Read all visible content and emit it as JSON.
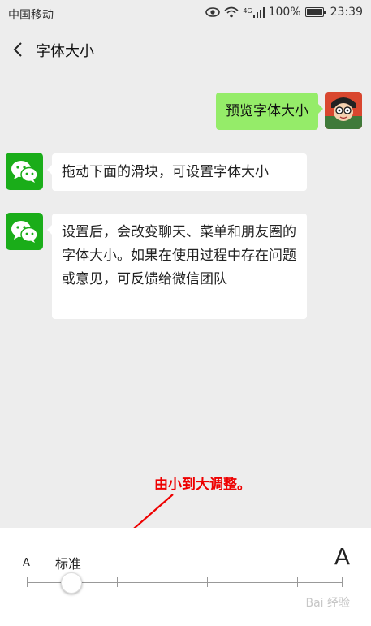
{
  "status_bar": {
    "carrier": "中国移动",
    "network": "4G",
    "battery": "100%",
    "time": "23:39"
  },
  "nav": {
    "title": "字体大小"
  },
  "messages": {
    "preview": "预览字体大小",
    "msg1": "拖动下面的滑块，可设置字体大小",
    "msg2": "设置后，会改变聊天、菜单和朋友圈的字体大小。如果在使用过程中存在问题或意见，可反馈给微信团队"
  },
  "annotation": {
    "text": "由小到大调整。"
  },
  "font_panel": {
    "small_label": "A",
    "standard_label": "标准",
    "large_label": "A",
    "level": 2,
    "levels": 8
  },
  "watermark": "Bai 经验",
  "colors": {
    "wechat_green": "#1aad19",
    "sent_bubble": "#95ec69",
    "annotation_red": "#e00000"
  }
}
